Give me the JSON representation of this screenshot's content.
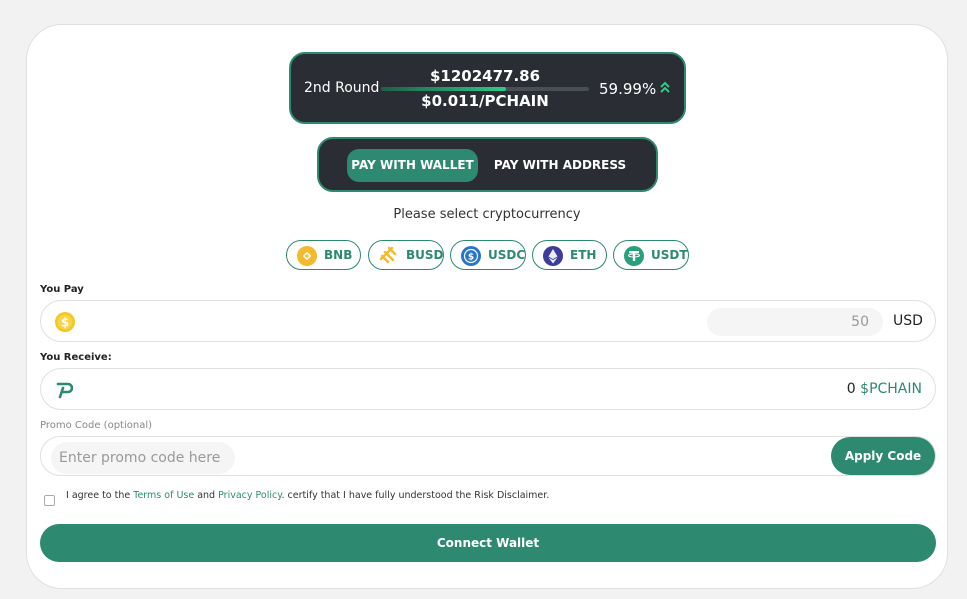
{
  "round": {
    "label": "2nd Round",
    "amount": "$1202477.86",
    "price": "$0.011/PCHAIN",
    "percent": "59.99%",
    "progress_fraction": 0.5999
  },
  "pay_toggle": {
    "wallet_label": "PAY WITH WALLET",
    "address_label": "PAY WITH ADDRESS",
    "active": "wallet"
  },
  "select_label": "Please select cryptocurrency",
  "cryptos": [
    {
      "label": "BNB",
      "icon": "bnb-icon"
    },
    {
      "label": "BUSD",
      "icon": "busd-icon"
    },
    {
      "label": "USDC",
      "icon": "usdc-icon"
    },
    {
      "label": "ETH",
      "icon": "eth-icon"
    },
    {
      "label": "USDT",
      "icon": "usdt-icon"
    }
  ],
  "you_pay": {
    "label": "You Pay",
    "amount": "50",
    "currency": "USD",
    "icon": "dollar-coin-icon"
  },
  "you_receive": {
    "label": "You Receive:",
    "amount": "0",
    "currency": "$PCHAIN",
    "icon": "pchain-logo-icon"
  },
  "promo": {
    "label": "Promo Code (optional)",
    "placeholder": "Enter promo code here",
    "value": "",
    "apply_label": "Apply Code"
  },
  "agreement": {
    "prefix": "I agree to the",
    "terms": "Terms of Use",
    "and": "and",
    "privacy": "Privacy Policy",
    "suffix": ". certify that I have fully understood the Risk Disclaimer.",
    "checked": false
  },
  "connect_label": "Connect Wallet",
  "colors": {
    "accent": "#2d8a70",
    "dark_panel": "#2a2d33",
    "bnb": "#f3ba2f",
    "usdc": "#2775ca",
    "eth": "#3c3c9d",
    "usdt": "#26a17b"
  }
}
